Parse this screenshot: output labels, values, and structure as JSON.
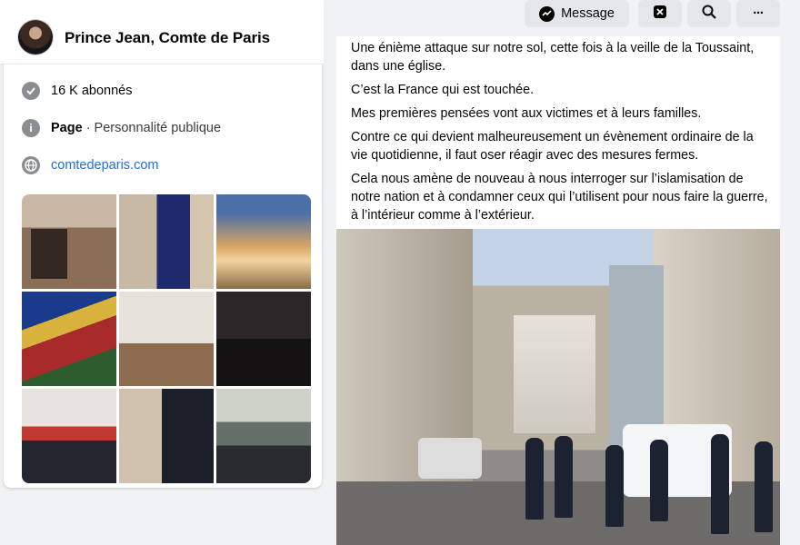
{
  "profile": {
    "name": "Prince Jean, Comte de Paris",
    "avatar_icon": "profile-photo"
  },
  "intro": {
    "followers": "16 K abonnés",
    "page_label": "Page",
    "page_category": " · Personnalité publique",
    "website": "comtedeparis.com"
  },
  "photos": [
    {
      "subject": "fireplace-family"
    },
    {
      "subject": "family-tapestry"
    },
    {
      "subject": "notre-dame"
    },
    {
      "subject": "stained-glass-king"
    },
    {
      "subject": "desk-meeting"
    },
    {
      "subject": "funeral-crowd"
    },
    {
      "subject": "guards-parade"
    },
    {
      "subject": "couple-portrait"
    },
    {
      "subject": "outdoor-group"
    }
  ],
  "actions": {
    "message_label": "Message",
    "message_icon": "messenger-icon",
    "block_icon": "x-box-icon",
    "search_icon": "search-icon",
    "more_icon": "more-icon",
    "more_glyph": "···"
  },
  "post": {
    "paragraphs": [
      "Une énième attaque sur notre sol, cette fois à la veille de la Toussaint, dans une église.",
      "C’est la France qui est touchée.",
      "Mes premières pensées vont aux victimes et à leurs familles.",
      "Contre ce qui devient malheureusement un évènement ordinaire de la vie quotidienne, il faut oser réagir avec des mesures fermes.",
      "Cela nous amène de nouveau à nous interroger sur l’islamisation de notre nation et à condamner ceux qui l’utilisent pour nous faire la guerre, à l’intérieur comme à l’extérieur."
    ]
  },
  "colors": {
    "link": "#216fdb",
    "background": "#f0f2f5",
    "button": "#e4e6eb"
  }
}
